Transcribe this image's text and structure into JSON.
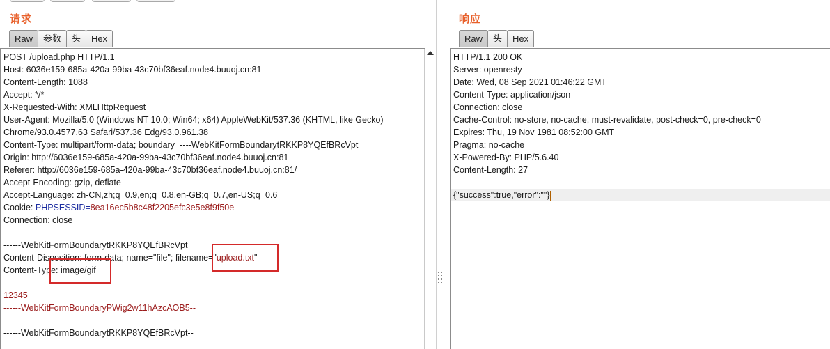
{
  "request": {
    "title": "请求",
    "tabs": [
      "Raw",
      "参数",
      "头",
      "Hex"
    ],
    "lines": [
      {
        "t": "POST /upload.php HTTP/1.1"
      },
      {
        "t": "Host: 6036e159-685a-420a-99ba-43c70bf36eaf.node4.buuoj.cn:81"
      },
      {
        "t": "Content-Length: 1088"
      },
      {
        "t": "Accept: */*"
      },
      {
        "t": "X-Requested-With: XMLHttpRequest"
      },
      {
        "t": "User-Agent: Mozilla/5.0 (Windows NT 10.0; Win64; x64) AppleWebKit/537.36 (KHTML, like Gecko)"
      },
      {
        "t": "Chrome/93.0.4577.63 Safari/537.36 Edg/93.0.961.38"
      },
      {
        "t": "Content-Type: multipart/form-data; boundary=----WebKitFormBoundarytRKKP8YQEfBRcVpt"
      },
      {
        "t": "Origin: http://6036e159-685a-420a-99ba-43c70bf36eaf.node4.buuoj.cn:81"
      },
      {
        "t": "Referer: http://6036e159-685a-420a-99ba-43c70bf36eaf.node4.buuoj.cn:81/"
      },
      {
        "t": "Accept-Encoding: gzip, deflate"
      },
      {
        "t": "Accept-Language: zh-CN,zh;q=0.9,en;q=0.8,en-GB;q=0.7,en-US;q=0.6"
      },
      {
        "cookie": true,
        "key": "Cookie: ",
        "name": "PHPSESSID",
        "eq": "=",
        "value": "8ea16ec5b8c48f2205efc3e5e8f9f50e"
      },
      {
        "t": "Connection: close"
      },
      {
        "t": ""
      },
      {
        "t": "------WebKitFormBoundarytRKKP8YQEfBRcVpt"
      },
      {
        "disp": true,
        "pre": "Content-Disposition: form-data; name=\"file\"; filename=\"",
        "fname": "upload.txt",
        "post": "\""
      },
      {
        "t": "Content-Type: image/gif"
      },
      {
        "t": ""
      },
      {
        "t": "12345",
        "red": true
      },
      {
        "t": "------WebKitFormBoundaryPWig2w11hAzcAOB5--",
        "red": true
      },
      {
        "t": ""
      },
      {
        "t": "------WebKitFormBoundarytRKKP8YQEfBRcVpt--"
      }
    ]
  },
  "response": {
    "title": "响应",
    "tabs": [
      "Raw",
      "头",
      "Hex"
    ],
    "lines": [
      "HTTP/1.1 200 OK",
      "Server: openresty",
      "Date: Wed, 08 Sep 2021 01:46:22 GMT",
      "Content-Type: application/json",
      "Connection: close",
      "Cache-Control: no-store, no-cache, must-revalidate, post-check=0, pre-check=0",
      "Expires: Thu, 19 Nov 1981 08:52:00 GMT",
      "Pragma: no-cache",
      "X-Powered-By: PHP/5.6.40",
      "Content-Length: 27",
      "",
      "{\"success\":true,\"error\":\"\"}"
    ]
  }
}
